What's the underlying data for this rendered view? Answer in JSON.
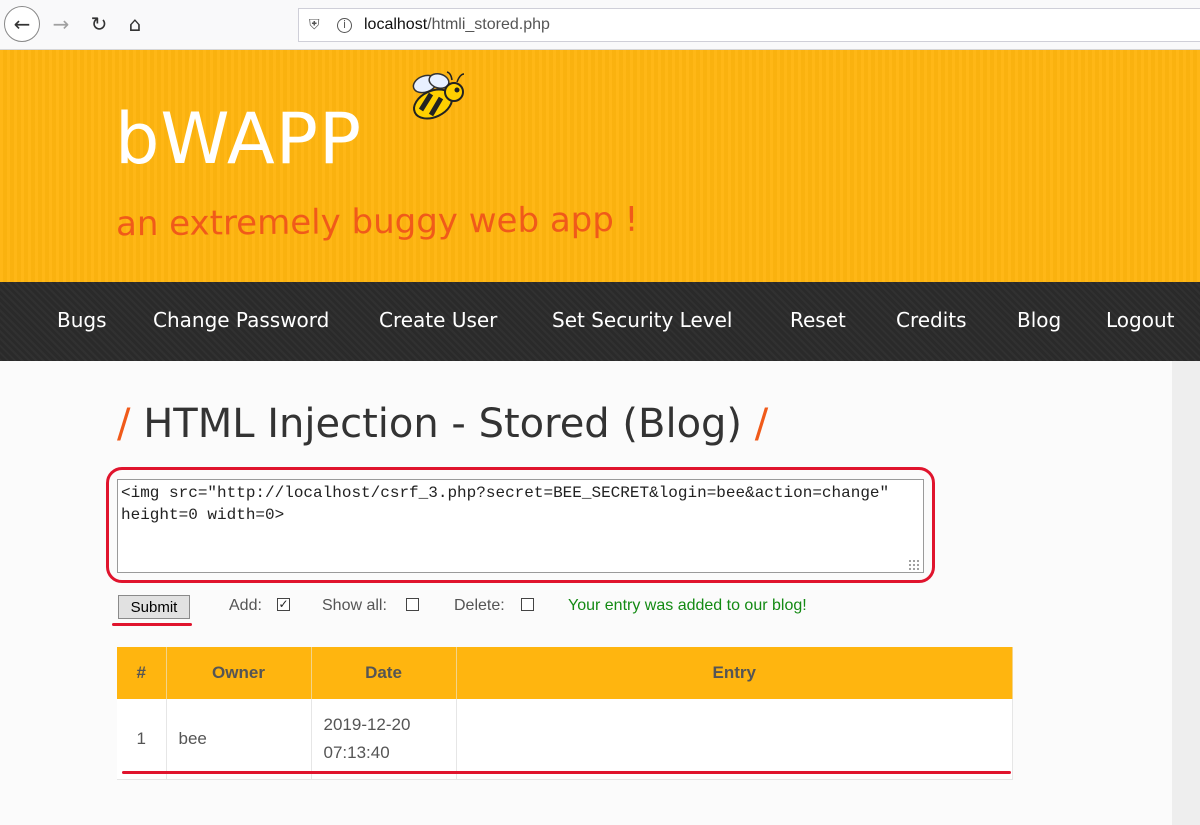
{
  "browser": {
    "url_host": "localhost",
    "url_path": "/htmli_stored.php"
  },
  "header": {
    "logo": "bWAPP",
    "tagline": "an extremely buggy web app !"
  },
  "menu": {
    "items": [
      "Bugs",
      "Change Password",
      "Create User",
      "Set Security Level",
      "Reset",
      "Credits",
      "Blog",
      "Logout"
    ]
  },
  "page": {
    "title": "HTML Injection - Stored (Blog)",
    "slash": "/"
  },
  "form": {
    "entry_value": "<img src=\"http://localhost/csrf_3.php?secret=BEE_SECRET&login=bee&action=change\" height=0 width=0>",
    "submit_label": "Submit",
    "add_label": "Add:",
    "add_checked": true,
    "show_all_label": "Show all:",
    "show_all_checked": false,
    "delete_label": "Delete:",
    "delete_checked": false,
    "status_message": "Your entry was added to our blog!"
  },
  "table": {
    "headers": [
      "#",
      "Owner",
      "Date",
      "Entry"
    ],
    "rows": [
      {
        "id": "1",
        "owner": "bee",
        "date": "2019-12-20",
        "time": "07:13:40",
        "entry": ""
      }
    ]
  },
  "colors": {
    "header_bg": "#ffb50f",
    "accent": "#f05a1a",
    "highlight": "#e0142d",
    "success": "#138a13"
  }
}
